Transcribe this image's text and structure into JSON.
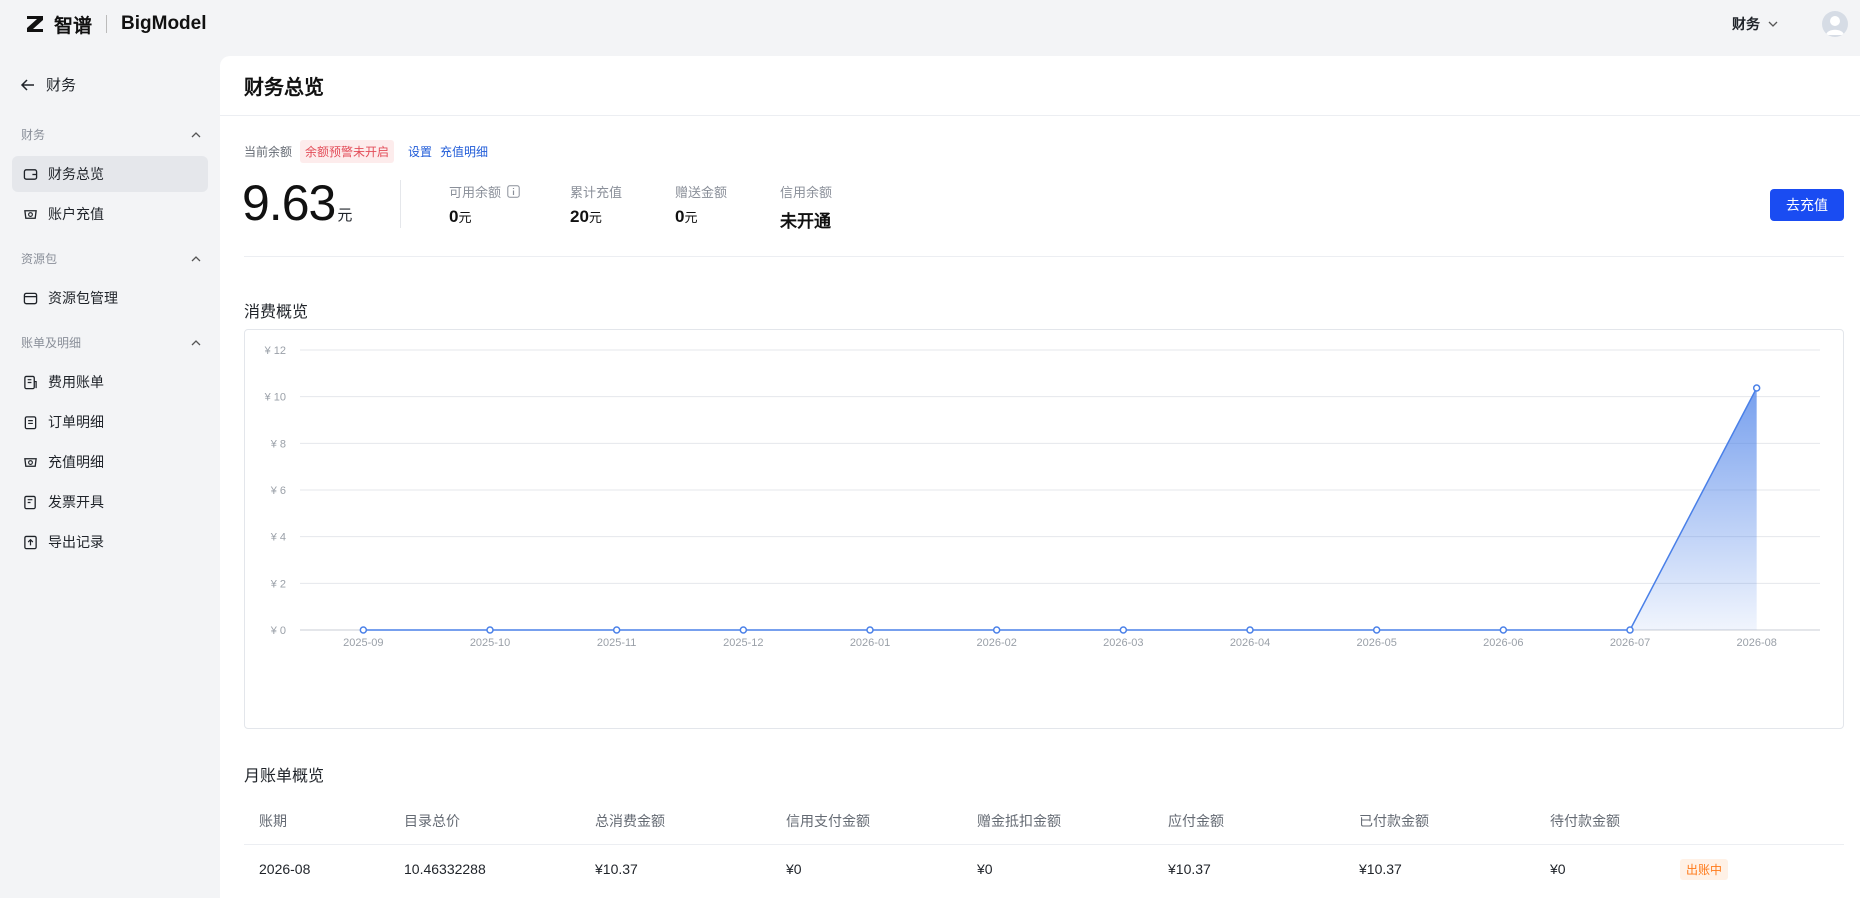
{
  "brand": {
    "name_cn": "智谱",
    "name_en": "BigModel"
  },
  "topbar": {
    "menu_label": "财务"
  },
  "sidebar": {
    "back_label": "财务",
    "groups": [
      {
        "title": "财务",
        "items": [
          {
            "label": "财务总览",
            "icon": "wallet-icon",
            "active": true
          },
          {
            "label": "账户充值",
            "icon": "piggy-bank-icon"
          }
        ]
      },
      {
        "title": "资源包",
        "items": [
          {
            "label": "资源包管理",
            "icon": "package-icon"
          }
        ]
      },
      {
        "title": "账单及明细",
        "items": [
          {
            "label": "费用账单",
            "icon": "bill-icon"
          },
          {
            "label": "订单明细",
            "icon": "clipboard-icon"
          },
          {
            "label": "充值明细",
            "icon": "piggy-bank-icon"
          },
          {
            "label": "发票开具",
            "icon": "invoice-icon"
          },
          {
            "label": "导出记录",
            "icon": "export-icon"
          }
        ]
      }
    ]
  },
  "page": {
    "title": "财务总览",
    "balance": {
      "label": "当前余额",
      "warning_tag": "余额预警未开启",
      "settings_link": "设置",
      "recharge_detail_link": "充值明细",
      "amount": "9.63",
      "unit": "元"
    },
    "stats": [
      {
        "label": "可用余额",
        "value": "0",
        "unit": "元",
        "has_info": true
      },
      {
        "label": "累计充值",
        "value": "20",
        "unit": "元"
      },
      {
        "label": "赠送金额",
        "value": "0",
        "unit": "元"
      },
      {
        "label": "信用余额",
        "value": "未开通",
        "unit": ""
      }
    ],
    "recharge_button": "去充值",
    "consumption_title": "消费概览",
    "monthly_title": "月账单概览",
    "table": {
      "headers": [
        "账期",
        "目录总价",
        "总消费金额",
        "信用支付金额",
        "赠金抵扣金额",
        "应付金额",
        "已付款金额",
        "待付款金额"
      ],
      "rows": [
        {
          "cells": [
            "2026-08",
            "10.46332288",
            "¥10.37",
            "¥0",
            "¥0",
            "¥10.37",
            "¥10.37",
            "¥0"
          ],
          "status": "出账中"
        }
      ]
    }
  },
  "chart_data": {
    "type": "area",
    "x": [
      "2025-09",
      "2025-10",
      "2025-11",
      "2025-12",
      "2026-01",
      "2026-02",
      "2026-03",
      "2026-04",
      "2026-05",
      "2026-06",
      "2026-07",
      "2026-08"
    ],
    "values": [
      0,
      0,
      0,
      0,
      0,
      0,
      0,
      0,
      0,
      0,
      0,
      10.37
    ],
    "ylim": [
      0,
      12
    ],
    "yticks": [
      0,
      2,
      4,
      6,
      8,
      10,
      12
    ],
    "ytick_prefix": "¥",
    "grid": true,
    "color": "#4a80e8"
  }
}
